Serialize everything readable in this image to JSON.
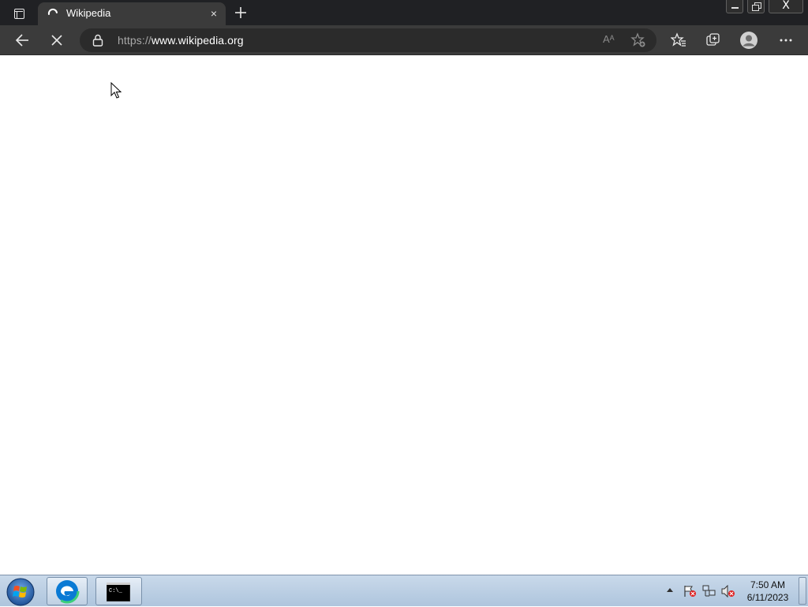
{
  "browser": {
    "tab": {
      "title": "Wikipedia",
      "close_glyph": "×",
      "icon": "loading-spinner-icon"
    },
    "new_tab_glyph": "+",
    "window_controls": {
      "close_glyph": "X"
    },
    "address": {
      "scheme": "https://",
      "host": "www.wikipedia.org"
    },
    "read_aloud_glyph": "Aᴬ",
    "toolbar_icons": [
      "back-arrow-icon",
      "stop-icon",
      "lock-icon",
      "read-aloud-icon",
      "add-favorite-icon",
      "favorites-icon",
      "collections-icon",
      "profile-icon",
      "more-icon"
    ]
  },
  "taskbar": {
    "clock_time": "7:50 AM",
    "clock_date": "6/11/2023",
    "items": [
      "start-orb-icon",
      "edge-icon",
      "command-prompt-icon"
    ],
    "tray_icons": [
      "action-center-flag-icon",
      "network-icon",
      "volume-muted-icon"
    ]
  },
  "colors": {
    "tab_bar": "#202124",
    "toolbar": "#3b3b3b",
    "address_bar": "#2b2b2b",
    "taskbar": "#aec5dd"
  }
}
